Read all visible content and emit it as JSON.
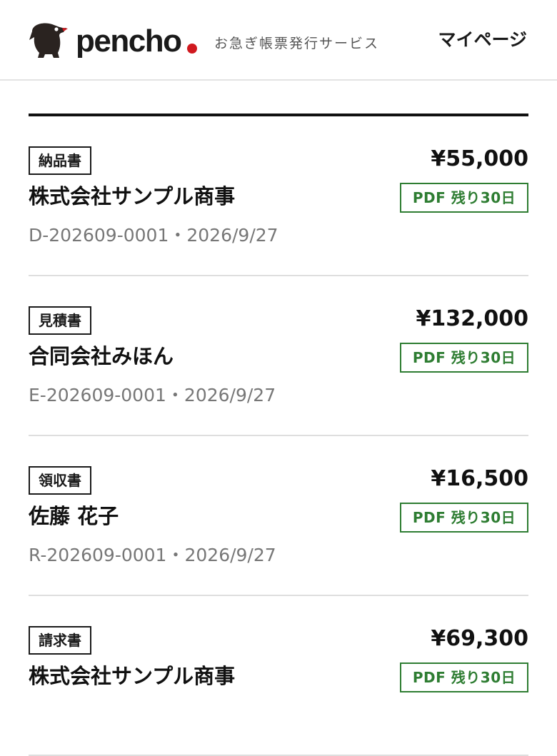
{
  "header": {
    "brand": "pencho",
    "tagline": "お急ぎ帳票発行サービス",
    "mypage_label": "マイページ"
  },
  "colors": {
    "accent_red": "#d0191f",
    "pdf_green": "#2e7d32",
    "text": "#1a1a1a",
    "muted": "#777777"
  },
  "icons": {
    "logo": "penguin-mascot-icon"
  },
  "documents": [
    {
      "type": "納品書",
      "amount": "¥55,000",
      "client": "株式会社サンプル商事",
      "pdf_status": "PDF 残り30日",
      "number": "D-202609-0001",
      "separator": "・",
      "date": "2026/9/27"
    },
    {
      "type": "見積書",
      "amount": "¥132,000",
      "client": "合同会社みほん",
      "pdf_status": "PDF 残り30日",
      "number": "E-202609-0001",
      "separator": "・",
      "date": "2026/9/27"
    },
    {
      "type": "領収書",
      "amount": "¥16,500",
      "client": "佐藤 花子",
      "pdf_status": "PDF 残り30日",
      "number": "R-202609-0001",
      "separator": "・",
      "date": "2026/9/27"
    },
    {
      "type": "請求書",
      "amount": "¥69,300",
      "client": "株式会社サンプル商事",
      "pdf_status": "PDF 残り30日",
      "number": "",
      "separator": "",
      "date": ""
    }
  ]
}
